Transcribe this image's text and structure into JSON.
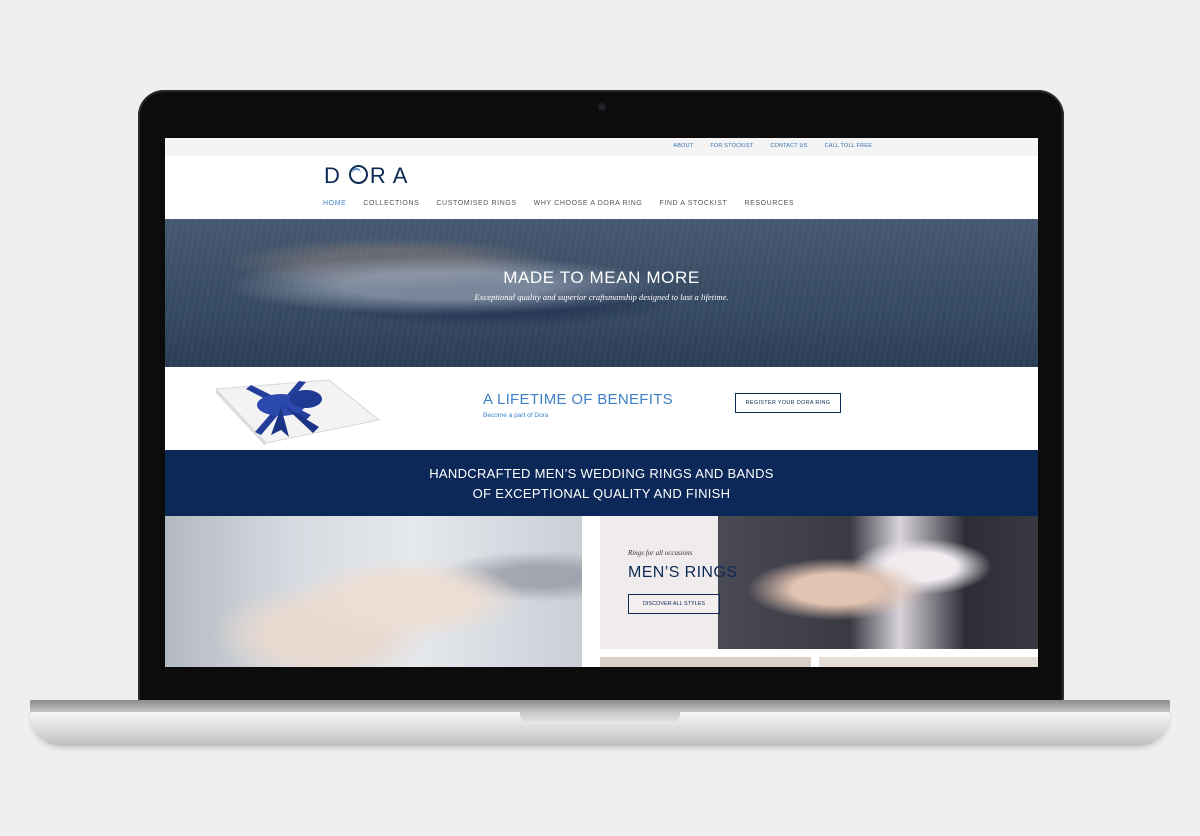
{
  "top_links": [
    "ABOUT",
    "FOR STOCKIST",
    "CONTACT US",
    "CALL TOLL FREE"
  ],
  "brand": {
    "logo_left": "D",
    "logo_right": "RA"
  },
  "nav": [
    "HOME",
    "COLLECTIONS",
    "CUSTOMISED RINGS",
    "WHY CHOOSE A DORA RING",
    "FIND A STOCKIST",
    "RESOURCES"
  ],
  "hero": {
    "title": "MADE TO MEAN MORE",
    "subtitle": "Exceptional quality and superior craftsmanship designed to last a lifetime."
  },
  "benefits": {
    "title": "A LIFETIME OF BENEFITS",
    "subtitle": "Become a part of Dora",
    "button": "REGISTER YOUR DORA RING"
  },
  "banner": {
    "line1": "HANDCRAFTED MEN’S WEDDING RINGS AND BANDS",
    "line2": "OF EXCEPTIONAL QUALITY AND FINISH"
  },
  "mens_rings": {
    "kicker": "Rings for all occasions",
    "title": "MEN’S RINGS",
    "button": "DISCOVER ALL STYLES"
  },
  "colors": {
    "navy": "#0c2858",
    "accent_blue": "#3f82c7"
  }
}
